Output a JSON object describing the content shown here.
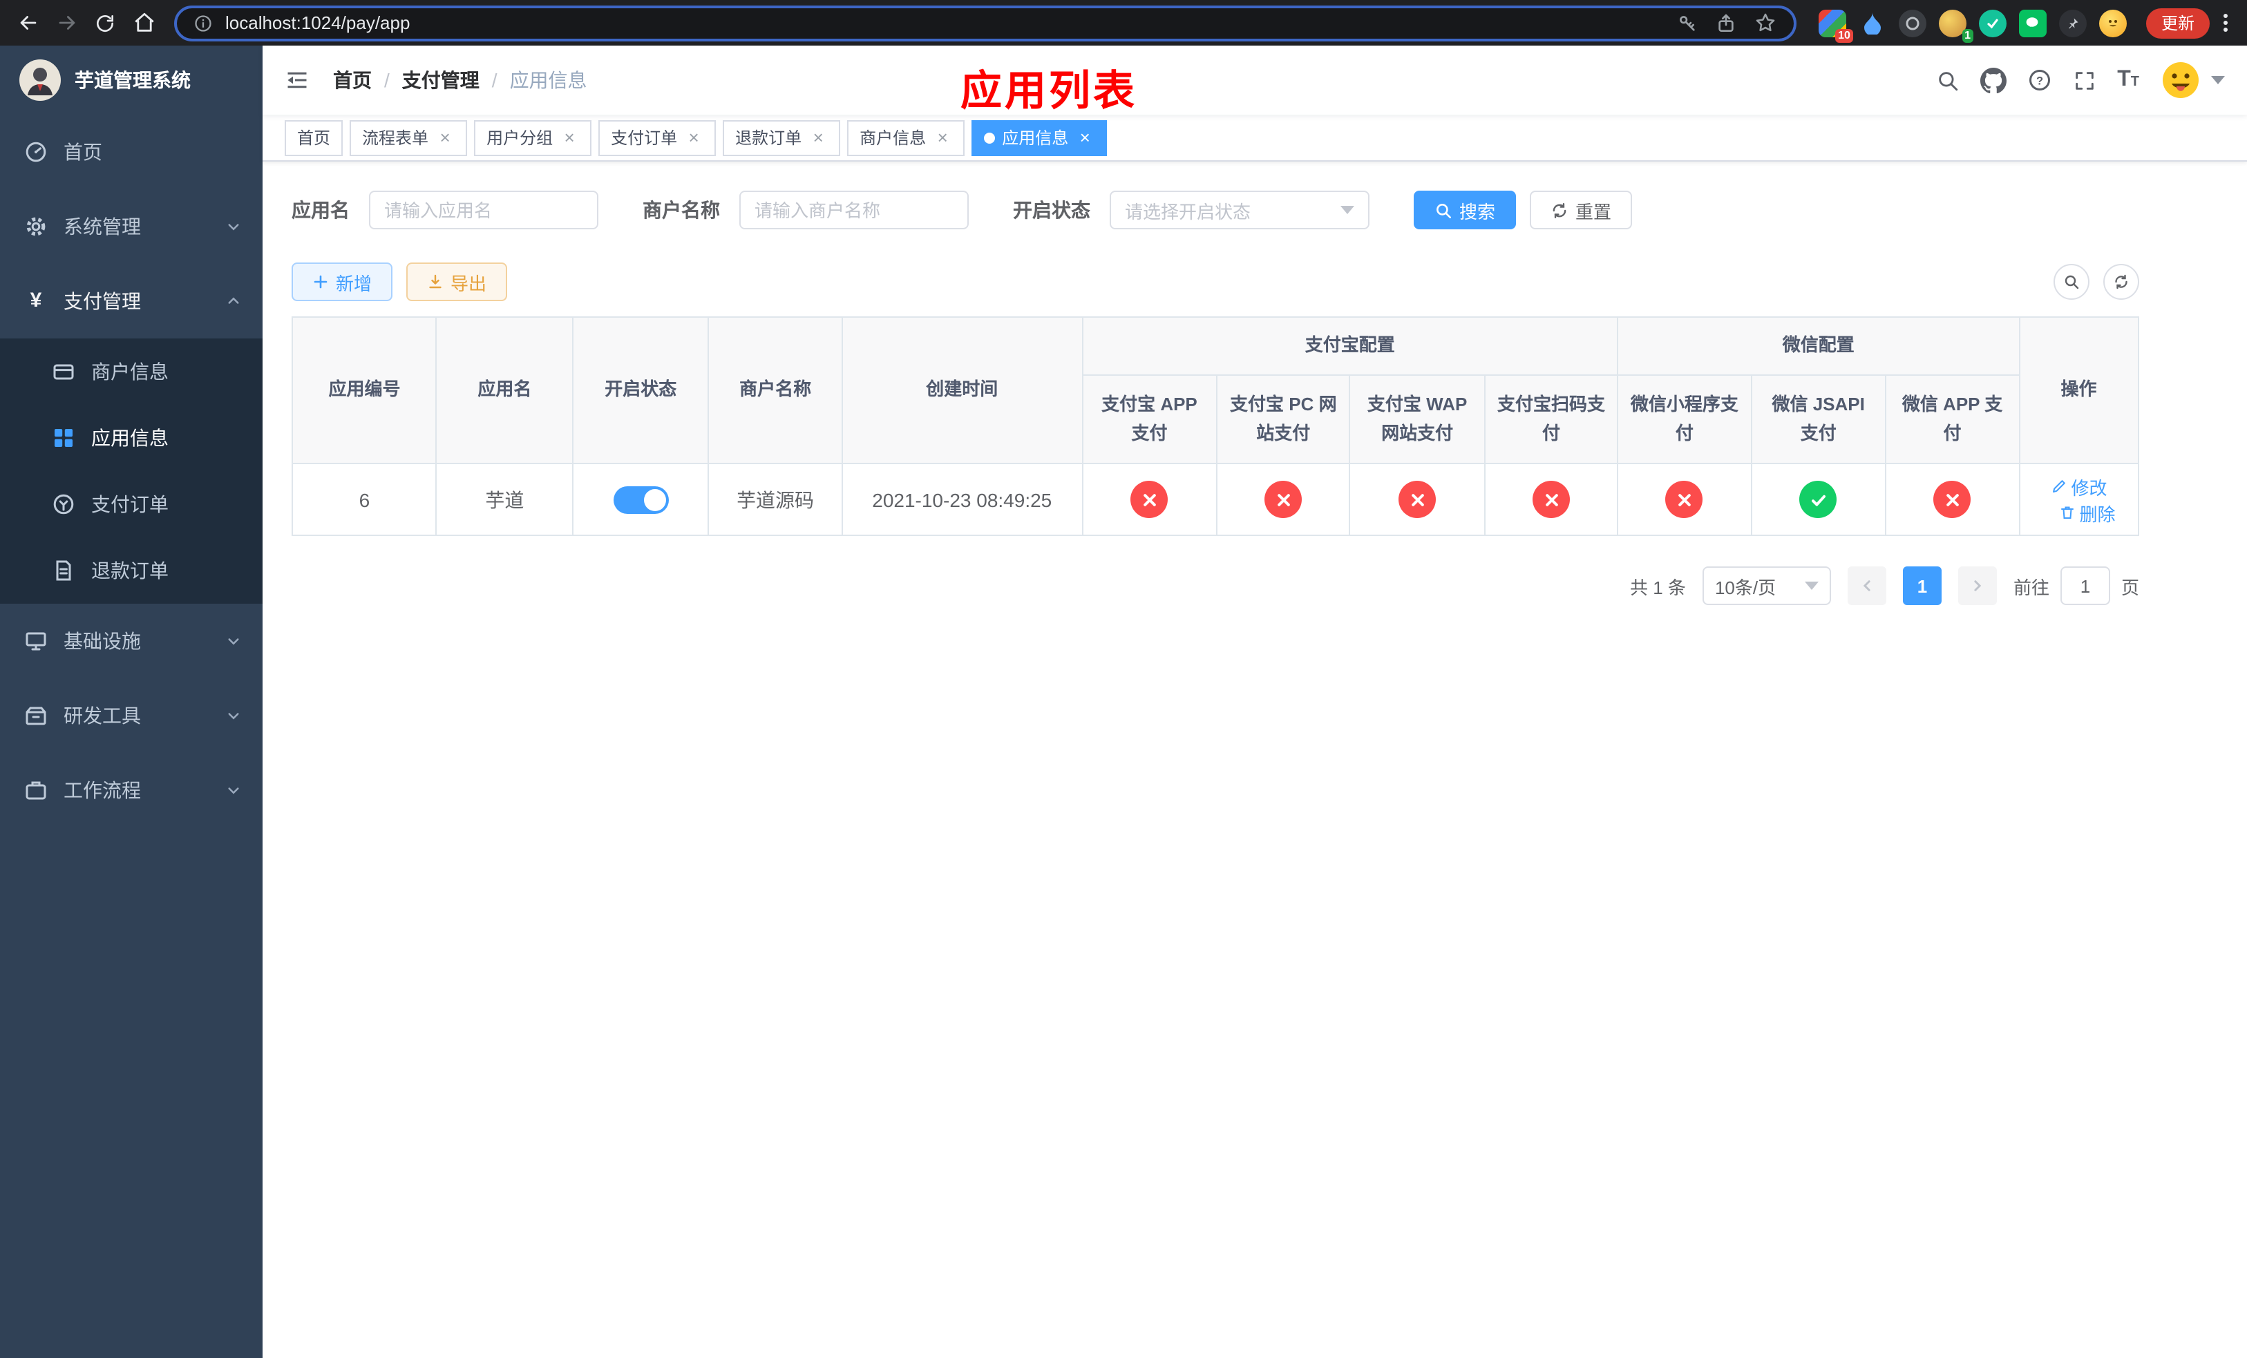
{
  "browser": {
    "url": "localhost:1024/pay/app",
    "update_label": "更新",
    "ext_badge_1": "10",
    "ext_badge_2": "1"
  },
  "sidebar": {
    "title": "芋道管理系统",
    "menu": {
      "home": "首页",
      "system": "系统管理",
      "payment": "支付管理",
      "merchant": "商户信息",
      "app": "应用信息",
      "pay_order": "支付订单",
      "refund_order": "退款订单",
      "infra": "基础设施",
      "dev_tools": "研发工具",
      "workflow": "工作流程"
    }
  },
  "header": {
    "breadcrumb": {
      "l1": "首页",
      "l2": "支付管理",
      "l3": "应用信息"
    },
    "annotation": "应用列表"
  },
  "tabs": {
    "t0": "首页",
    "t1": "流程表单",
    "t2": "用户分组",
    "t3": "支付订单",
    "t4": "退款订单",
    "t5": "商户信息",
    "t6": "应用信息"
  },
  "filters": {
    "app_name_label": "应用名",
    "app_name_placeholder": "请输入应用名",
    "merchant_label": "商户名称",
    "merchant_placeholder": "请输入商户名称",
    "status_label": "开启状态",
    "status_placeholder": "请选择开启状态",
    "search_button": "搜索",
    "reset_button": "重置"
  },
  "toolbar": {
    "add": "新增",
    "export": "导出"
  },
  "table": {
    "headers": {
      "app_id": "应用编号",
      "app_name": "应用名",
      "status": "开启状态",
      "merchant": "商户名称",
      "created": "创建时间",
      "alipay_group": "支付宝配置",
      "alipay_app": "支付宝 APP 支付",
      "alipay_pc": "支付宝 PC 网站支付",
      "alipay_wap": "支付宝 WAP 网站支付",
      "alipay_qr": "支付宝扫码支付",
      "wx_group": "微信配置",
      "wx_mini": "微信小程序支付",
      "wx_jsapi": "微信 JSAPI 支付",
      "wx_app": "微信 APP 支付",
      "actions": "操作"
    },
    "row": {
      "id": "6",
      "name": "芋道",
      "enabled": true,
      "merchant": "芋道源码",
      "created": "2021-10-23 08:49:25",
      "alipay_app": false,
      "alipay_pc": false,
      "alipay_wap": false,
      "alipay_qr": false,
      "wx_mini": false,
      "wx_jsapi": true,
      "wx_app": false,
      "edit": "修改",
      "delete": "删除"
    }
  },
  "pagination": {
    "total": "共 1 条",
    "page_size": "10条/页",
    "page": "1",
    "goto_label": "前往",
    "goto_value": "1",
    "goto_suffix": "页"
  }
}
